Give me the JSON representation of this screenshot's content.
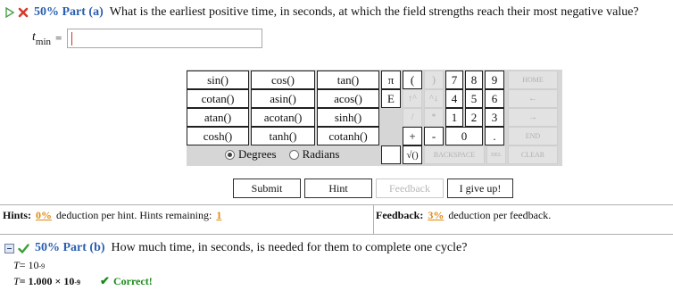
{
  "part_a": {
    "percent": "50% Part (a)",
    "question": "What is the earliest positive time, in seconds, at which the field strengths reach their most negative value?",
    "variable": "t",
    "variable_sub": "min",
    "equals": "=",
    "input_value": ""
  },
  "keypad": {
    "functions": [
      [
        "sin()",
        "cos()",
        "tan()"
      ],
      [
        "cotan()",
        "asin()",
        "acos()"
      ],
      [
        "atan()",
        "acotan()",
        "sinh()"
      ],
      [
        "cosh()",
        "tanh()",
        "cotanh()"
      ]
    ],
    "pi": "π",
    "open_paren": "(",
    "close_paren": ")",
    "e": "E",
    "up_arrow_1": "↑^",
    "up_arrow_2": "^↓",
    "slash": "/",
    "star": "*",
    "plus": "+",
    "minus": "-",
    "sqrt": "√()",
    "digits": [
      "7",
      "8",
      "9",
      "4",
      "5",
      "6",
      "1",
      "2",
      "3",
      "0",
      "."
    ],
    "home": "HOME",
    "left": "←",
    "right": "→",
    "end": "END",
    "backspace": "BACKSPACE",
    "del": "DEL",
    "clear": "CLEAR",
    "degrees": "Degrees",
    "radians": "Radians",
    "angle_mode": "Degrees"
  },
  "actions": {
    "submit": "Submit",
    "hint": "Hint",
    "feedback": "Feedback",
    "give_up": "I give up!"
  },
  "info": {
    "hints_label": "Hints:",
    "hints_pct": "0%",
    "hints_text": "deduction per hint. Hints remaining:",
    "hints_remaining": "1",
    "feedback_label": "Feedback:",
    "feedback_pct": "3%",
    "feedback_text": "deduction per feedback."
  },
  "part_b": {
    "percent": "50% Part (b)",
    "question": "How much time, in seconds, is needed for them to complete one cycle?",
    "entered_var": "T",
    "entered_eq": " = 10",
    "entered_exp": "-9",
    "result_var": "T",
    "result_eq": " = 1.000 × 10",
    "result_exp": "-9",
    "correct": "Correct!"
  },
  "colors": {
    "accent_blue": "#2a5fb0",
    "orange": "#e08a10",
    "green": "#1a8a1a",
    "error_red": "#d83030"
  }
}
